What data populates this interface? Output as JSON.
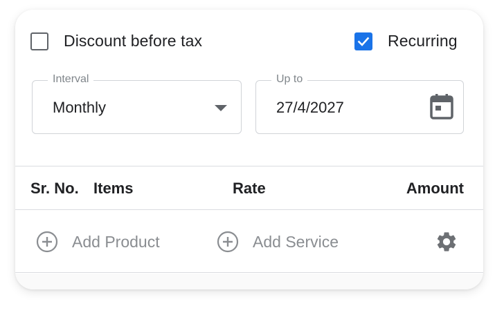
{
  "options": {
    "discount_before_tax": {
      "label": "Discount before tax",
      "checked": false
    },
    "recurring": {
      "label": "Recurring",
      "checked": true
    }
  },
  "interval": {
    "legend": "Interval",
    "value": "Monthly",
    "icon": "dropdown-arrow-icon"
  },
  "upto": {
    "legend": "Up to",
    "value": "27/4/2027",
    "icon": "calendar-icon"
  },
  "table": {
    "columns": [
      "Sr. No.",
      "Items",
      "Rate",
      "Amount"
    ]
  },
  "actions": {
    "add_product": "Add Product",
    "add_service": "Add Service",
    "settings_icon": "gear-icon"
  },
  "colors": {
    "accent": "#1a73e8",
    "muted_text": "#8a8d91",
    "border": "#d0d3d7"
  }
}
